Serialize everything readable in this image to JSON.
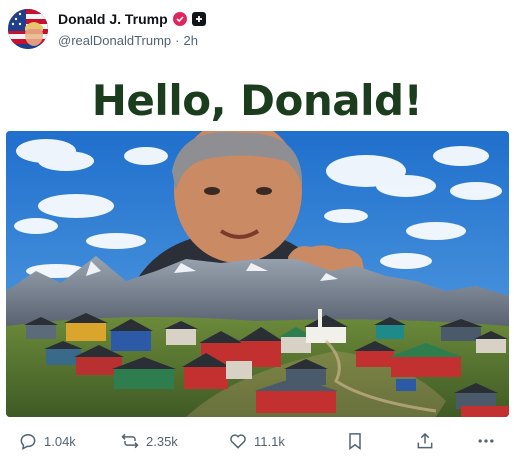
{
  "post": {
    "author_name": "Donald J. Trump",
    "handle": "@realDonaldTrump",
    "separator": "·",
    "time": "2h",
    "headline": "Hello, Donald!",
    "media_icon": "image-of-man-over-greenland-village"
  },
  "actions": {
    "replies": "1.04k",
    "reposts": "2.35k",
    "likes": "11.1k"
  },
  "icons": {
    "verified": "verified-badge-icon",
    "plus": "plus-badge-icon",
    "reply": "reply-icon",
    "repost": "repost-icon",
    "like": "heart-icon",
    "bookmark": "bookmark-icon",
    "share": "share-icon",
    "more": "more-icon"
  },
  "colors": {
    "headline": "#1b3d1e",
    "verified_badge": "#e0245e",
    "muted_text": "#536471",
    "sky": "#2d7fd0"
  }
}
